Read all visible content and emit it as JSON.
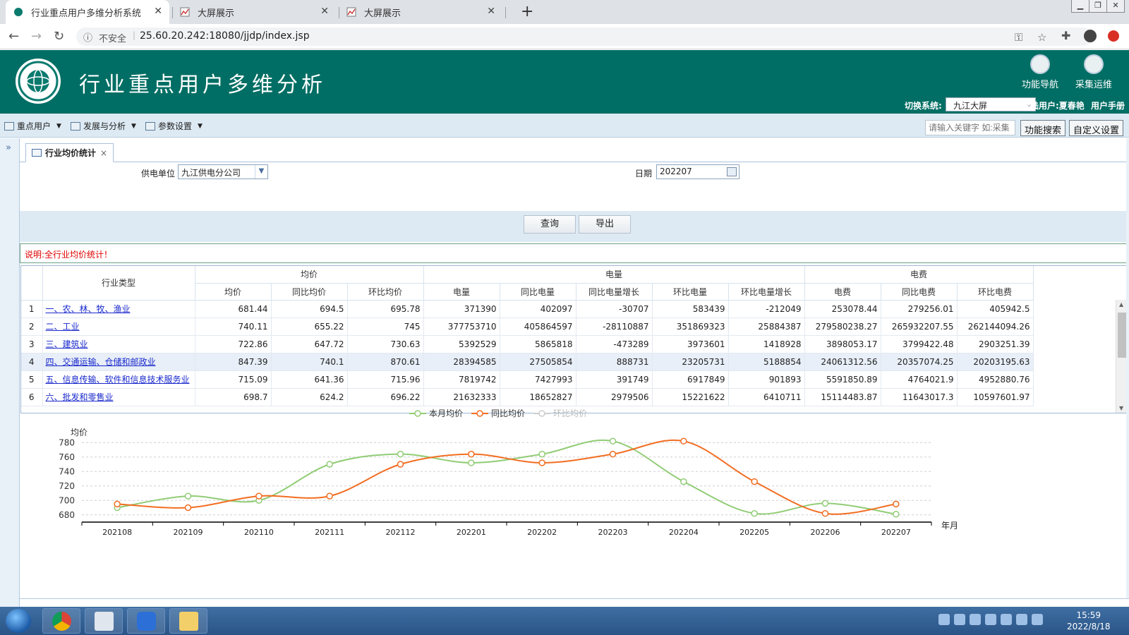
{
  "browser": {
    "tabs": [
      {
        "title": "行业重点用户多维分析系统"
      },
      {
        "title": "大屏展示"
      },
      {
        "title": "大屏展示"
      }
    ],
    "security_label": "不安全",
    "url": "25.60.20.242:18080/jjdp/index.jsp"
  },
  "header": {
    "title": "行业重点用户多维分析",
    "tool_nav": "功能导航",
    "tool_ops": "采集运维",
    "switch_label": "切换系统:",
    "switch_value": "九江大屏",
    "login_user": "登陆用户:夏春艳",
    "manual": "用户手册"
  },
  "menu": {
    "items": [
      {
        "label": "重点用户"
      },
      {
        "label": "发展与分析"
      },
      {
        "label": "参数设置"
      }
    ],
    "search_placeholder": "请输入关键字 如:采集",
    "search_button": "功能搜索",
    "custom_button": "自定义设置"
  },
  "page_tab": {
    "label": "行业均价统计",
    "close": "×"
  },
  "filter": {
    "unit_label": "供电单位",
    "unit_value": "九江供电分公司",
    "date_label": "日期",
    "date_value": "202207",
    "query_button": "查询",
    "export_button": "导出"
  },
  "note": "说明:全行业均价统计！",
  "table": {
    "group_headers": {
      "type": "行业类型",
      "price": "均价",
      "energy": "电量",
      "fee": "电费"
    },
    "columns": [
      "均价",
      "同比均价",
      "环比均价",
      "电量",
      "同比电量",
      "同比电量增长",
      "环比电量",
      "环比电量增长",
      "电费",
      "同比电费",
      "环比电费"
    ],
    "rows": [
      {
        "n": "1",
        "name": "一、农、林、牧、渔业",
        "v": [
          "681.44",
          "694.5",
          "695.78",
          "371390",
          "402097",
          "-30707",
          "583439",
          "-212049",
          "253078.44",
          "279256.01",
          "405942.5"
        ]
      },
      {
        "n": "2",
        "name": "二、工业",
        "v": [
          "740.11",
          "655.22",
          "745",
          "377753710",
          "405864597",
          "-28110887",
          "351869323",
          "25884387",
          "279580238.27",
          "265932207.55",
          "262144094.26"
        ]
      },
      {
        "n": "3",
        "name": "三、建筑业",
        "v": [
          "722.86",
          "647.72",
          "730.63",
          "5392529",
          "5865818",
          "-473289",
          "3973601",
          "1418928",
          "3898053.17",
          "3799422.48",
          "2903251.39"
        ]
      },
      {
        "n": "4",
        "name": "四、交通运输、仓储和邮政业",
        "v": [
          "847.39",
          "740.1",
          "870.61",
          "28394585",
          "27505854",
          "888731",
          "23205731",
          "5188854",
          "24061312.56",
          "20357074.25",
          "20203195.63"
        ]
      },
      {
        "n": "5",
        "name": "五、信息传输、软件和信息技术服务业",
        "v": [
          "715.09",
          "641.36",
          "715.96",
          "7819742",
          "7427993",
          "391749",
          "6917849",
          "901893",
          "5591850.89",
          "4764021.9",
          "4952880.76"
        ]
      },
      {
        "n": "6",
        "name": "六、批发和零售业",
        "v": [
          "698.7",
          "624.2",
          "696.22",
          "21632333",
          "18652827",
          "2979506",
          "15221622",
          "6410711",
          "15114483.87",
          "11643017.3",
          "10597601.97"
        ]
      }
    ]
  },
  "chart_data": {
    "type": "line",
    "ylabel": "均价",
    "xlabel": "年月",
    "categories": [
      "202108",
      "202109",
      "202110",
      "202111",
      "202112",
      "202201",
      "202202",
      "202203",
      "202204",
      "202205",
      "202206",
      "202207"
    ],
    "ylim": [
      670,
      790
    ],
    "yticks": [
      680,
      700,
      720,
      740,
      760,
      780
    ],
    "grid": true,
    "legend": "top-center",
    "series": [
      {
        "name": "本月均价",
        "color": "#91cc75",
        "values": [
          690,
          706,
          700,
          750,
          764,
          752,
          764,
          782,
          726,
          682,
          696,
          681
        ]
      },
      {
        "name": "同比均价",
        "color": "#f26d21",
        "values": [
          695,
          690,
          706,
          706,
          750,
          764,
          752,
          764,
          782,
          726,
          682,
          695
        ]
      },
      {
        "name": "环比均价",
        "color": "#cccccc",
        "hidden": true,
        "values": []
      }
    ]
  },
  "taskbar": {
    "time": "15:59",
    "date": "2022/8/18"
  }
}
